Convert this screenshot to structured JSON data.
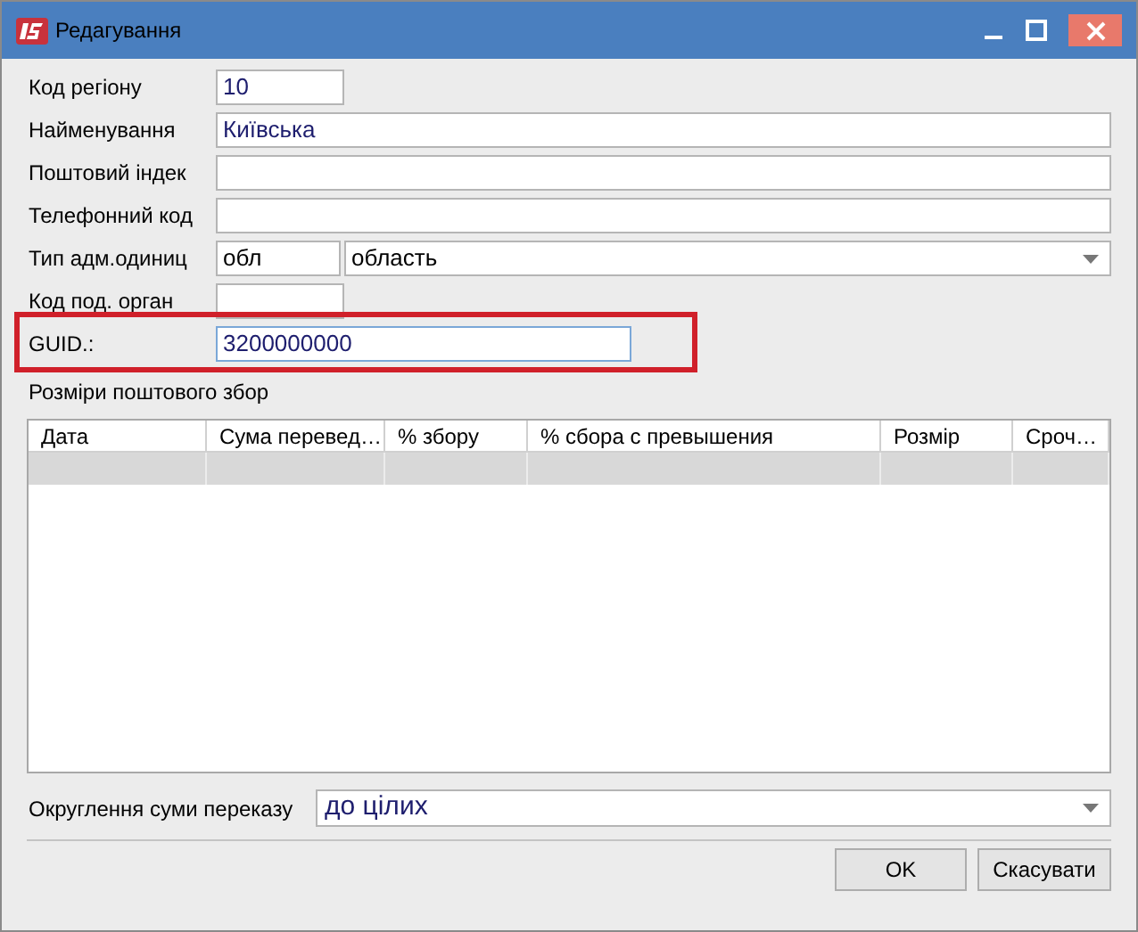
{
  "window": {
    "title": "Редагування"
  },
  "fields": [
    {
      "label": "Код регіону",
      "kind": "short",
      "value": "10",
      "focused": false,
      "highlighted": false
    },
    {
      "label": "Найменування",
      "kind": "text",
      "value": "Київська",
      "focused": false,
      "highlighted": false
    },
    {
      "label": "Поштовий індек",
      "kind": "text",
      "focused": false,
      "highlighted": false
    },
    {
      "label": "Телефонний код",
      "kind": "text",
      "focused": false,
      "highlighted": false
    },
    {
      "label": "Тип адм.одиниц",
      "kind": "code_combo",
      "code": "обл",
      "value": "область",
      "focused": false,
      "highlighted": false
    },
    {
      "label": "Код под. орган",
      "kind": "short",
      "focused": false,
      "highlighted": false
    },
    {
      "label": "GUID.:",
      "kind": "medium",
      "value": "3200000000",
      "focused": true,
      "highlighted": true
    }
  ],
  "fees": {
    "title": "Розміри поштового збор",
    "columns": [
      "Дата",
      "Сума перевед…",
      "% збору",
      "% сбора с превышения",
      "Розмір",
      "Сроч…"
    ],
    "rows": [
      {
        "selected": true
      }
    ]
  },
  "rounding": {
    "label": "Округлення суми переказу",
    "value": "до цілих"
  },
  "buttons": [
    "OK",
    "Скасувати"
  ]
}
